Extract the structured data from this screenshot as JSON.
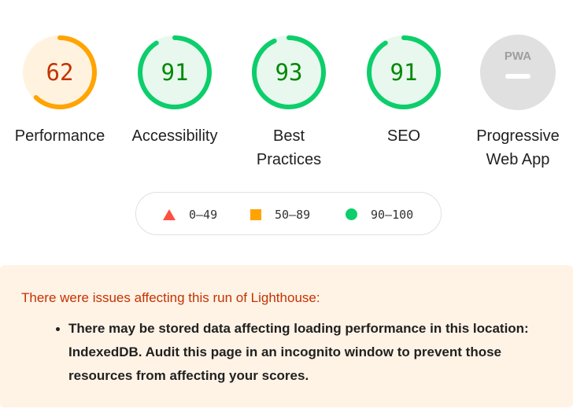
{
  "categories": [
    {
      "id": "performance",
      "label": "Performance",
      "score": "62",
      "score_value": 62,
      "rating": "average"
    },
    {
      "id": "accessibility",
      "label": "Accessibility",
      "score": "91",
      "score_value": 91,
      "rating": "pass"
    },
    {
      "id": "best-practices",
      "label": "Best Practices",
      "score": "93",
      "score_value": 93,
      "rating": "pass"
    },
    {
      "id": "seo",
      "label": "SEO",
      "score": "91",
      "score_value": 91,
      "rating": "pass"
    },
    {
      "id": "pwa",
      "label": "Progressive Web App",
      "badge": "PWA",
      "rating": "not-applicable"
    }
  ],
  "legend": {
    "fail": {
      "range": "0–49",
      "icon": "triangle-icon",
      "color": "#ff4e42"
    },
    "average": {
      "range": "50–89",
      "icon": "square-icon",
      "color": "#ffa400"
    },
    "pass": {
      "range": "90–100",
      "icon": "circle-icon",
      "color": "#0cce6b"
    }
  },
  "colors": {
    "pass": "#0cce6b",
    "pass_bg": "#e8f8ef",
    "average": "#ffa400",
    "average_text": "#c33300",
    "average_bg": "#fff3e0",
    "na": "#e0e0e0",
    "warning_bg": "#fff3e6"
  },
  "warning": {
    "title": "There were issues affecting this run of Lighthouse:",
    "items": [
      "There may be stored data affecting loading performance in this location: IndexedDB. Audit this page in an incognito window to prevent those resources from affecting your scores."
    ]
  }
}
